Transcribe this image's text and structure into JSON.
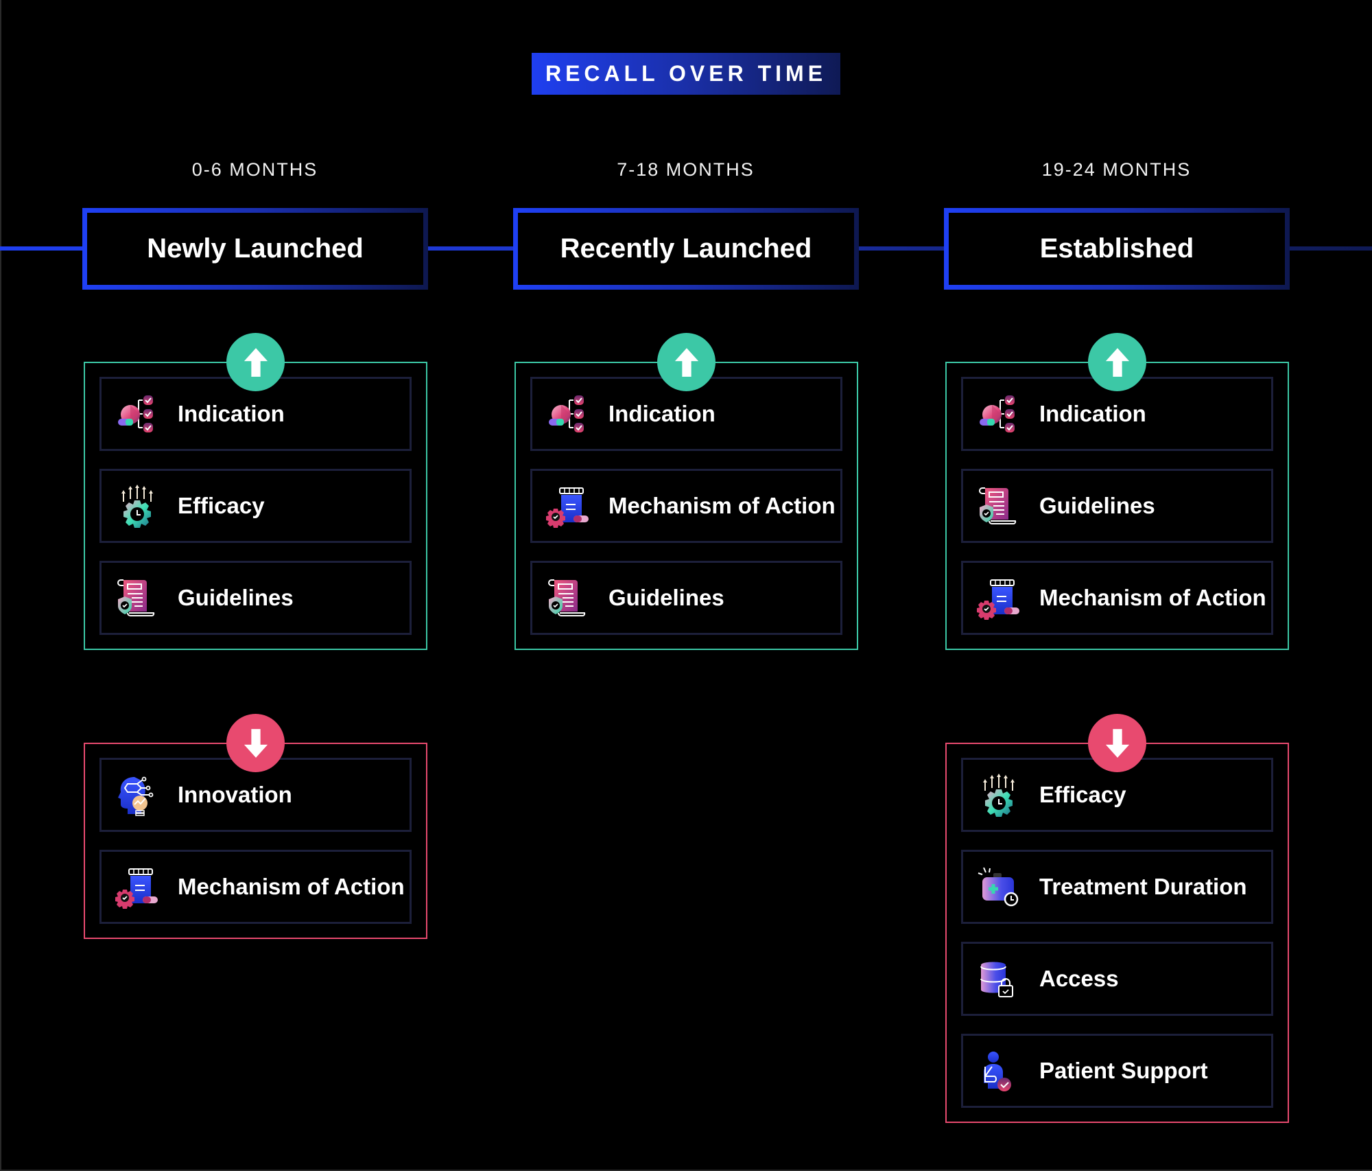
{
  "title": "RECALL OVER TIME",
  "colors": {
    "increase": "#3cc8a6",
    "decrease": "#e84a6f",
    "accent_blue": "#1f40f5",
    "item_border": "#1c1f3a"
  },
  "stages": [
    {
      "period": "0-6 MONTHS",
      "label": "Newly Launched",
      "increased": {
        "direction": "up",
        "icon": "arrow-up-icon",
        "items": [
          {
            "label": "Indication",
            "icon": "indication-icon"
          },
          {
            "label": "Efficacy",
            "icon": "efficacy-icon"
          },
          {
            "label": "Guidelines",
            "icon": "guidelines-icon"
          }
        ]
      },
      "decreased": {
        "direction": "down",
        "icon": "arrow-down-icon",
        "items": [
          {
            "label": "Innovation",
            "icon": "innovation-icon"
          },
          {
            "label": "Mechanism of Action",
            "icon": "mechanism-icon"
          }
        ]
      }
    },
    {
      "period": "7-18 MONTHS",
      "label": "Recently Launched",
      "increased": {
        "direction": "up",
        "icon": "arrow-up-icon",
        "items": [
          {
            "label": "Indication",
            "icon": "indication-icon"
          },
          {
            "label": "Mechanism of Action",
            "icon": "mechanism-icon"
          },
          {
            "label": "Guidelines",
            "icon": "guidelines-icon"
          }
        ]
      }
    },
    {
      "period": "19-24 MONTHS",
      "label": "Established",
      "increased": {
        "direction": "up",
        "icon": "arrow-up-icon",
        "items": [
          {
            "label": "Indication",
            "icon": "indication-icon"
          },
          {
            "label": "Guidelines",
            "icon": "guidelines-icon"
          },
          {
            "label": "Mechanism of Action",
            "icon": "mechanism-icon"
          }
        ]
      },
      "decreased": {
        "direction": "down",
        "icon": "arrow-down-icon",
        "items": [
          {
            "label": "Efficacy",
            "icon": "efficacy-icon"
          },
          {
            "label": "Treatment Duration",
            "icon": "treatment-duration-icon"
          },
          {
            "label": "Access",
            "icon": "access-icon"
          },
          {
            "label": "Patient Support",
            "icon": "patient-support-icon"
          }
        ]
      }
    }
  ]
}
